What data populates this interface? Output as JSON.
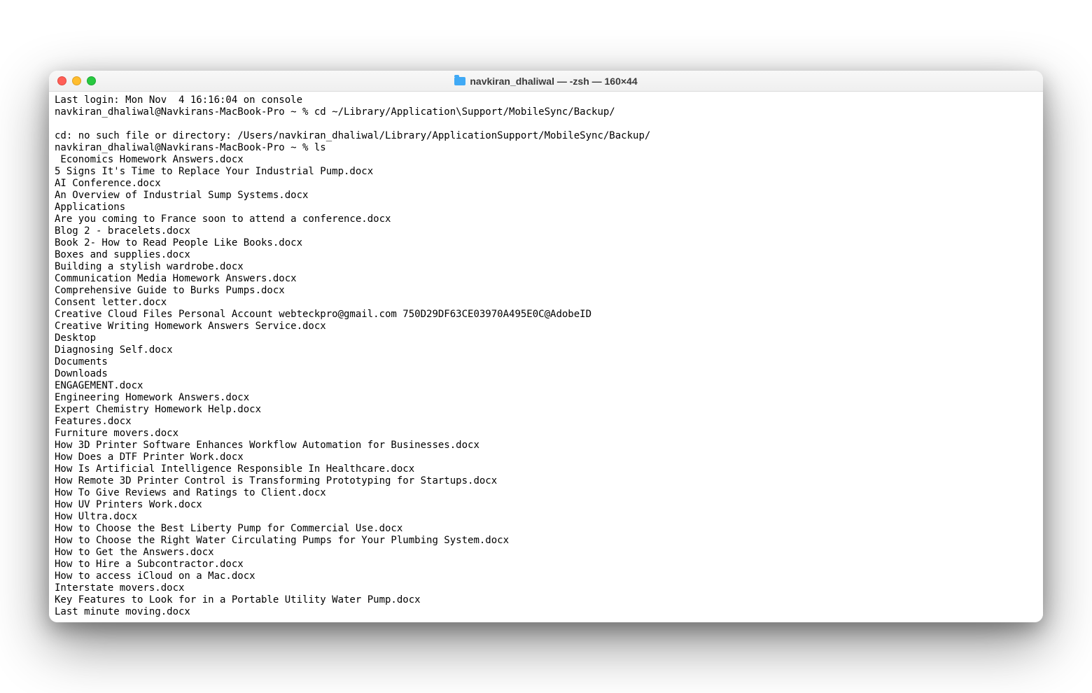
{
  "titlebar": {
    "title": "navkiran_dhaliwal — -zsh — 160×44"
  },
  "terminal": {
    "lines": [
      "Last login: Mon Nov  4 16:16:04 on console",
      "navkiran_dhaliwal@Navkirans-MacBook-Pro ~ % cd ~/Library/Application\\Support/MobileSync/Backup/",
      "",
      "cd: no such file or directory: /Users/navkiran_dhaliwal/Library/ApplicationSupport/MobileSync/Backup/",
      "navkiran_dhaliwal@Navkirans-MacBook-Pro ~ % ls",
      " Economics Homework Answers.docx",
      "5 Signs It's Time to Replace Your Industrial Pump.docx",
      "AI Conference.docx",
      "An Overview of Industrial Sump Systems.docx",
      "Applications",
      "Are you coming to France soon to attend a conference.docx",
      "Blog 2 - bracelets.docx",
      "Book 2- How to Read People Like Books.docx",
      "Boxes and supplies.docx",
      "Building a stylish wardrobe.docx",
      "Communication Media Homework Answers.docx",
      "Comprehensive Guide to Burks Pumps.docx",
      "Consent letter.docx",
      "Creative Cloud Files Personal Account webteckpro@gmail.com 750D29DF63CE03970A495E0C@AdobeID",
      "Creative Writing Homework Answers Service.docx",
      "Desktop",
      "Diagnosing Self.docx",
      "Documents",
      "Downloads",
      "ENGAGEMENT.docx",
      "Engineering Homework Answers.docx",
      "Expert Chemistry Homework Help.docx",
      "Features.docx",
      "Furniture movers.docx",
      "How 3D Printer Software Enhances Workflow Automation for Businesses.docx",
      "How Does a DTF Printer Work.docx",
      "How Is Artificial Intelligence Responsible In Healthcare.docx",
      "How Remote 3D Printer Control is Transforming Prototyping for Startups.docx",
      "How To Give Reviews and Ratings to Client.docx",
      "How UV Printers Work.docx",
      "How Ultra.docx",
      "How to Choose the Best Liberty Pump for Commercial Use.docx",
      "How to Choose the Right Water Circulating Pumps for Your Plumbing System.docx",
      "How to Get the Answers.docx",
      "How to Hire a Subcontractor.docx",
      "How to access iCloud on a Mac.docx",
      "Interstate movers.docx",
      "Key Features to Look for in a Portable Utility Water Pump.docx",
      "Last minute moving.docx"
    ]
  }
}
